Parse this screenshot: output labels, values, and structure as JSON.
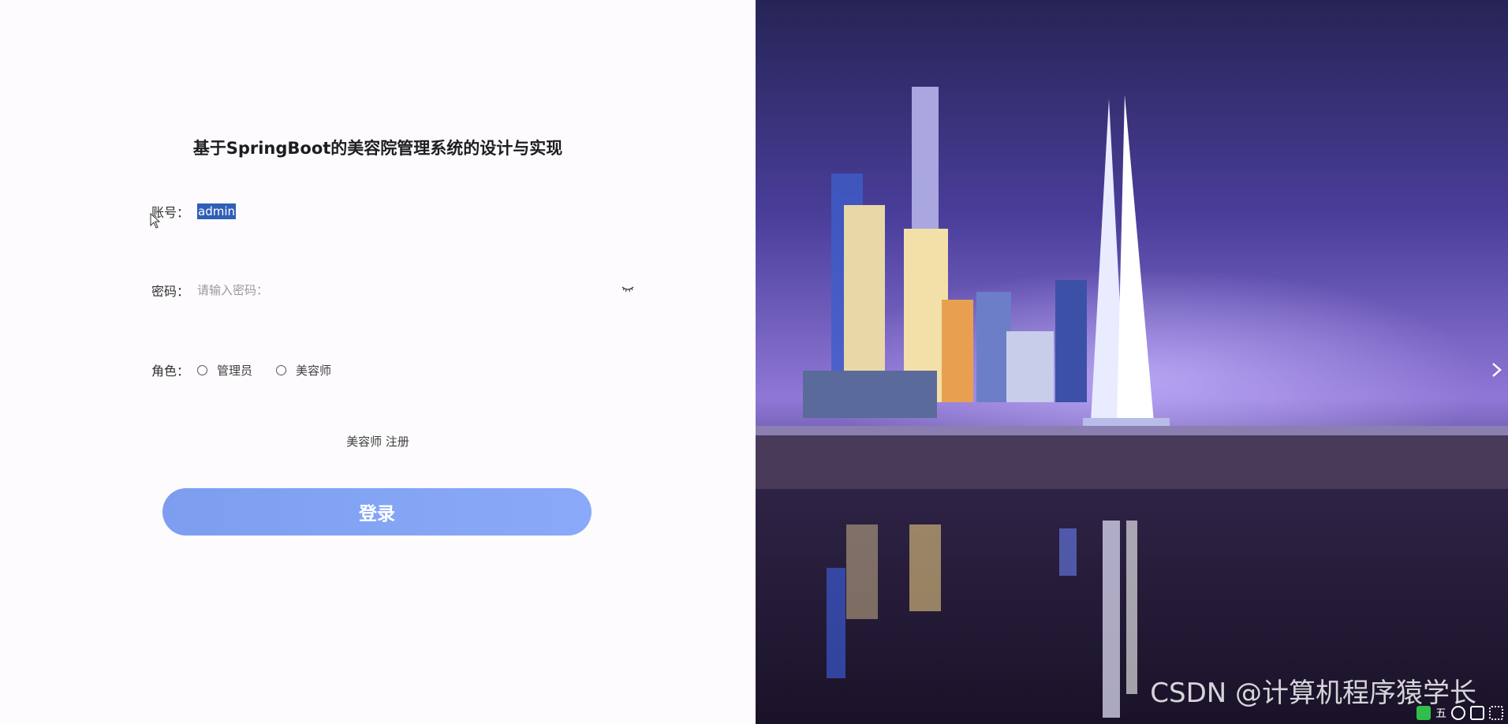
{
  "page": {
    "title": "基于SpringBoot的美容院管理系统的设计与实现"
  },
  "form": {
    "account_label": "账号：",
    "account_value": "admin",
    "password_label": "密码：",
    "password_placeholder": "请输入密码：",
    "role_label": "角色：",
    "roles": [
      "管理员",
      "美容师"
    ],
    "register_link": "美容师 注册",
    "login_button": "登录"
  },
  "watermark": "CSDN @计算机程序猿学长",
  "tray": {
    "ime_label": "五"
  },
  "colors": {
    "button": "#86a6f6",
    "selection": "#2f5fb6",
    "background": "#fdfbfd"
  }
}
